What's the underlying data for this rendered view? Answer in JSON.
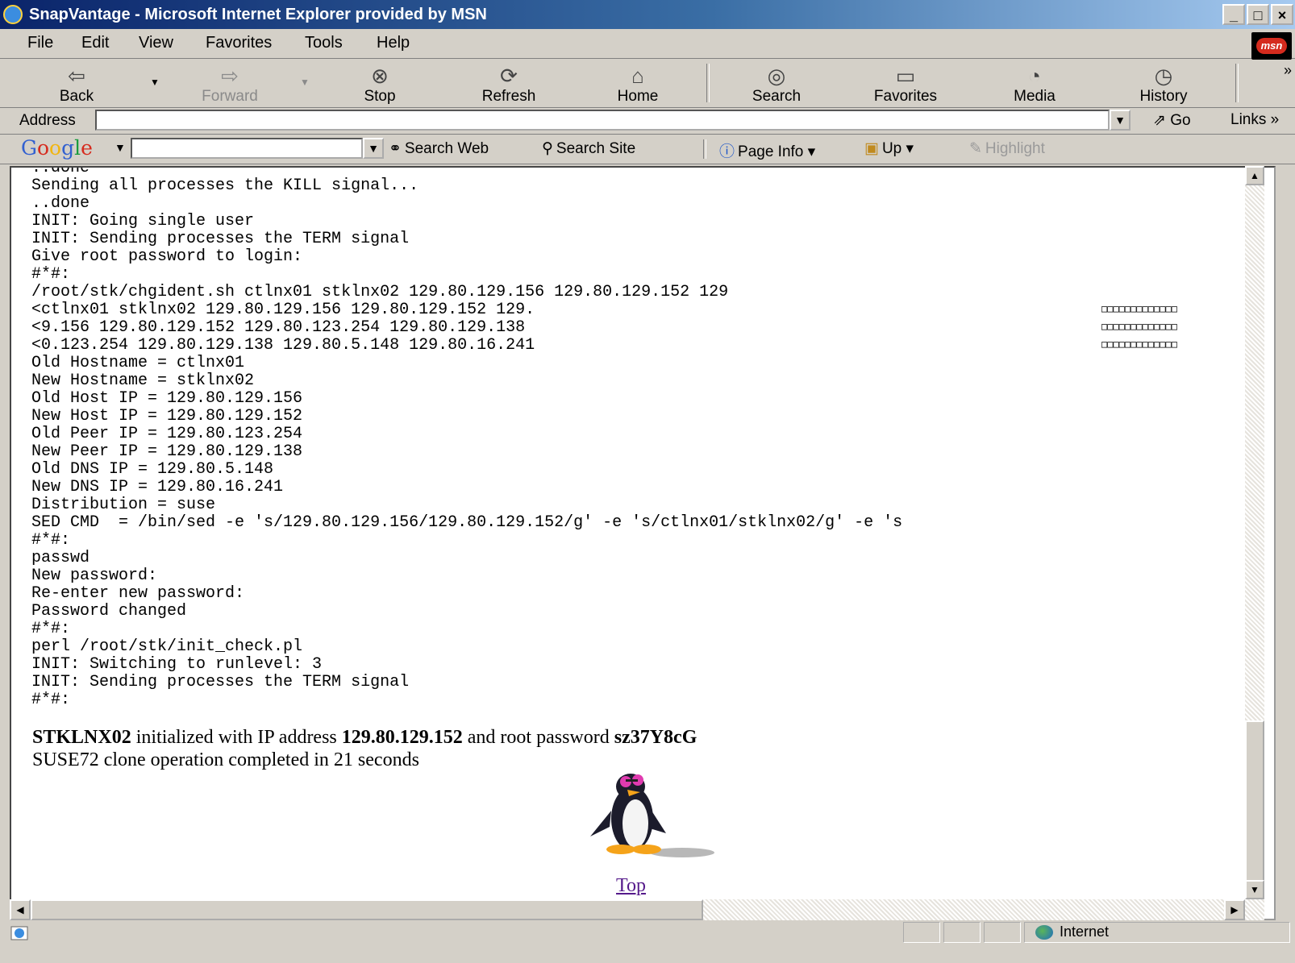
{
  "window": {
    "title": "SnapVantage - Microsoft Internet Explorer provided by MSN",
    "buttons": [
      "_",
      "□",
      "×"
    ]
  },
  "menu": {
    "items": [
      "File",
      "Edit",
      "View",
      "Favorites",
      "Tools",
      "Help"
    ],
    "msn_logo": "msn"
  },
  "toolbar": {
    "back": "Back",
    "forward": "Forward",
    "stop": "Stop",
    "refresh": "Refresh",
    "home": "Home",
    "search": "Search",
    "favorites": "Favorites",
    "media": "Media",
    "history": "History"
  },
  "address": {
    "label": "Address",
    "value": "",
    "go": "Go",
    "links": "Links"
  },
  "googlebar": {
    "logo": "Google",
    "search_web": "Search Web",
    "search_site": "Search Site",
    "page_info": "Page Info",
    "up": "Up",
    "highlight": "Highlight"
  },
  "console": {
    "text": "..done\nSending all processes the KILL signal...\n..done\nINIT: Going single user\nINIT: Sending processes the TERM signal\nGive root password to login:\n#*#:\n/root/stk/chgident.sh ctlnx01 stklnx02 129.80.129.156 129.80.129.152 129\n<ctlnx01 stklnx02 129.80.129.156 129.80.129.152 129.\n<9.156 129.80.129.152 129.80.123.254 129.80.129.138\n<0.123.254 129.80.129.138 129.80.5.148 129.80.16.241\nOld Hostname = ctlnx01\nNew Hostname = stklnx02\nOld Host IP = 129.80.129.156\nNew Host IP = 129.80.129.152\nOld Peer IP = 129.80.123.254\nNew Peer IP = 129.80.129.138\nOld DNS IP = 129.80.5.148\nNew DNS IP = 129.80.16.241\nDistribution = suse\nSED CMD  = /bin/sed -e 's/129.80.129.156/129.80.129.152/g' -e 's/ctlnx01/stklnx02/g' -e 's\n#*#:\npasswd\nNew password:\nRe-enter new password:\nPassword changed\n#*#:\nperl /root/stk/init_check.pl\nINIT: Switching to runlevel: 3\nINIT: Sending processes the TERM signal\n#*#:",
    "glyph_rows": "□□□□□□□□□□□□□\n□□□□□□□□□□□□□\n□□□□□□□□□□□□□"
  },
  "summary": {
    "host": "STKLNX02",
    "text1": " initialized with IP address ",
    "ip": "129.80.129.152",
    "text2": " and root password ",
    "password": "sz37Y8cG",
    "line2": "SUSE72 clone operation completed in 21 seconds"
  },
  "top_link": "Top",
  "status": {
    "zone": "Internet"
  }
}
